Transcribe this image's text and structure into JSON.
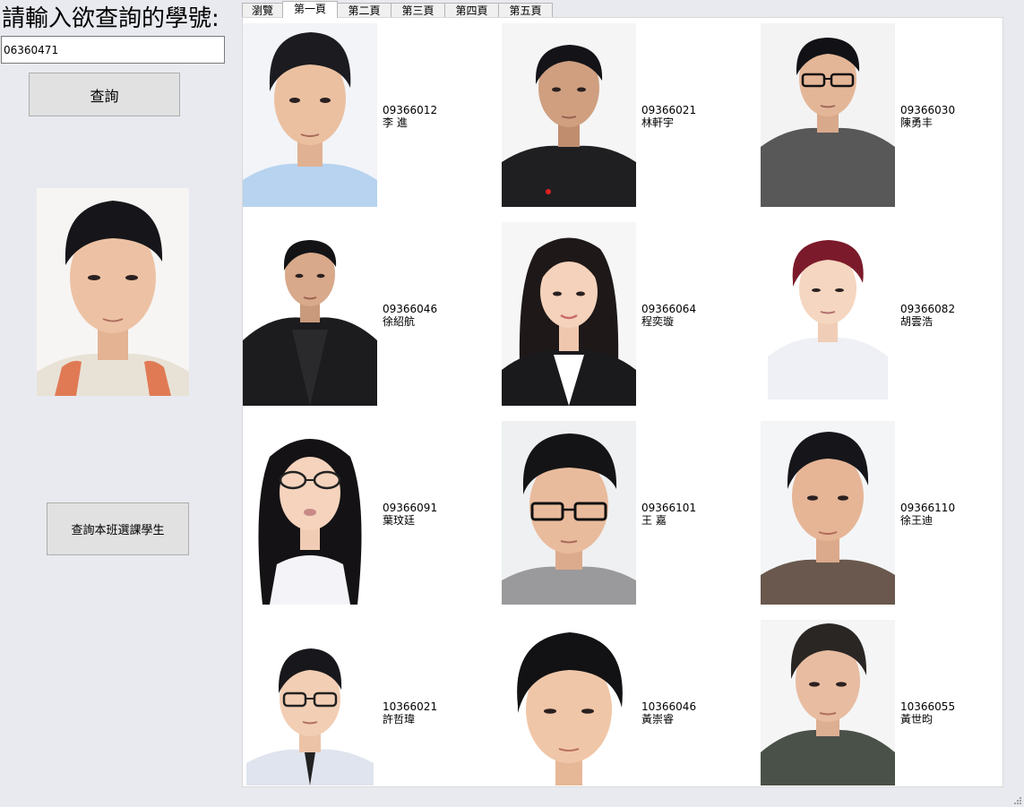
{
  "prompt": "請輸入欲查詢的學號:",
  "search": {
    "value": "06360471"
  },
  "query_button": "查詢",
  "class_button": "查詢本班選課學生",
  "tabs": [
    "瀏覽",
    "第一頁",
    "第二頁",
    "第三頁",
    "第四頁",
    "第五頁"
  ],
  "active_tab": 1,
  "students": [
    {
      "id": "09366012",
      "name": "李 進"
    },
    {
      "id": "09366021",
      "name": "林軒宇"
    },
    {
      "id": "09366030",
      "name": "陳勇丰"
    },
    {
      "id": "09366046",
      "name": "徐紹航"
    },
    {
      "id": "09366064",
      "name": "程奕璇"
    },
    {
      "id": "09366082",
      "name": "胡雲浩"
    },
    {
      "id": "09366091",
      "name": "葉玟廷"
    },
    {
      "id": "09366101",
      "name": "王 嘉"
    },
    {
      "id": "09366110",
      "name": "徐王迪"
    },
    {
      "id": "10366021",
      "name": "許哲瑋"
    },
    {
      "id": "10366046",
      "name": "黃崇睿"
    },
    {
      "id": "10366055",
      "name": "黃世昀"
    }
  ]
}
